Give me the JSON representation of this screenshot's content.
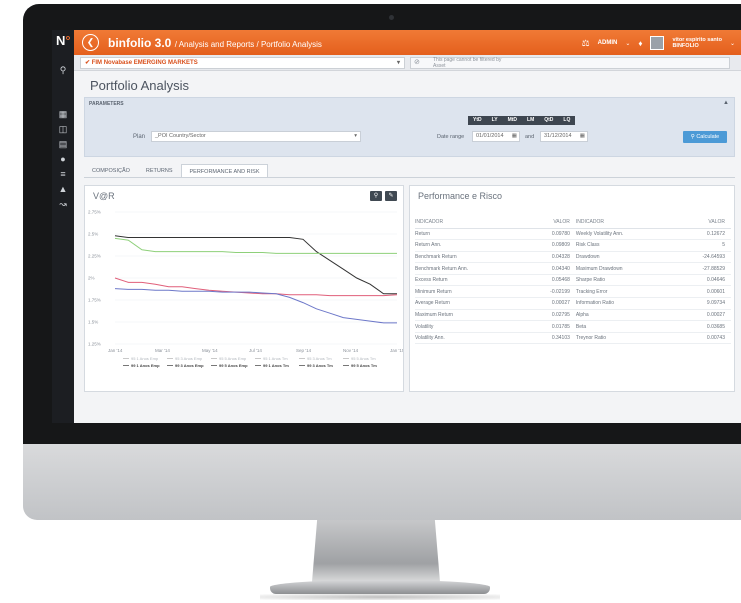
{
  "app": {
    "name": "binfolio 3.0",
    "breadcrumb": "/ Analysis and Reports / Portfolio Analysis",
    "back_icon": "chevron-left-icon"
  },
  "header": {
    "admin_label": "ADMIN",
    "user_name": "vitor espirito santo",
    "user_org": "BINFOLIO"
  },
  "toolbar": {
    "portfolio": "FIM Novabase EMERGING MARKETS",
    "filter_note_line1": "This page cannot be filtered by",
    "filter_note_line2": "Asset"
  },
  "page": {
    "title": "Portfolio Analysis"
  },
  "parameters": {
    "header": "PARAMETERS",
    "plan_label": "Plan",
    "plan_value": "_POI Country/Sector",
    "periods": [
      "YtD",
      "LY",
      "MtD",
      "LM",
      "QtD",
      "LQ"
    ],
    "date_range_label": "Date range",
    "date_from": "01/01/2014",
    "and_label": "and",
    "date_to": "31/12/2014",
    "calculate_label": "Calculate"
  },
  "tabs": [
    "COMPOSIÇÃO",
    "RETURNS",
    "PERFORMANCE AND RISK"
  ],
  "var_panel": {
    "title": "V@R"
  },
  "perf_panel": {
    "title": "Performance e Risco",
    "headers": [
      "INDICADOR",
      "VALOR",
      "INDICADOR",
      "VALOR"
    ],
    "rows": [
      [
        "Return",
        "0.09780",
        "Weekly Volatility Ann.",
        "0.12672"
      ],
      [
        "Return Ann.",
        "0.09809",
        "Risk Class",
        "5"
      ],
      [
        "Benchmark Return",
        "0.04328",
        "Drawdown",
        "-24.64593"
      ],
      [
        "Benchmark Return Ann.",
        "0.04340",
        "Maximum Drawdown",
        "-27.88529"
      ],
      [
        "Excess Return",
        "0.05468",
        "Sharpe Ratio",
        "0.04646"
      ],
      [
        "Minimum Return",
        "-0.02199",
        "Tracking Error",
        "0.00601"
      ],
      [
        "Average Return",
        "0.00027",
        "Information Ratio",
        "9.09734"
      ],
      [
        "Maximum Return",
        "0.02795",
        "Alpha",
        "0.00027"
      ],
      [
        "Volatility",
        "0.01785",
        "Beta",
        "0.03685"
      ],
      [
        "Volatility Ann.",
        "0.34103",
        "Treynor Ratio",
        "0.00743"
      ]
    ]
  },
  "chart_data": {
    "type": "line",
    "title": "V@R",
    "x": [
      "Jan '14",
      "Mar '14",
      "May '14",
      "Jul '14",
      "Sep '14",
      "Nov '14",
      "Jan '15"
    ],
    "y_ticks": [
      "1.25%",
      "1.5%",
      "1.75%",
      "2%",
      "2.25%",
      "2.5%",
      "2.75%"
    ],
    "ylim": [
      1.25,
      2.75
    ],
    "series": [
      {
        "name": "99 1 Anos Emp",
        "color": "#333333",
        "values": [
          2.48,
          2.46,
          2.46,
          2.46,
          2.46,
          2.46,
          2.46,
          2.46,
          2.46,
          2.46,
          2.46,
          2.46,
          2.46,
          2.46,
          2.44,
          2.3,
          2.2,
          2.1,
          2.0,
          1.93,
          1.82,
          1.82
        ]
      },
      {
        "name": "99 5 Anos Emp",
        "color": "#8ed07a",
        "values": [
          2.45,
          2.43,
          2.32,
          2.3,
          2.3,
          2.3,
          2.3,
          2.3,
          2.3,
          2.29,
          2.29,
          2.29,
          2.28,
          2.28,
          2.28,
          2.28,
          2.28,
          2.28,
          2.28,
          2.28,
          2.28,
          2.28
        ]
      },
      {
        "name": "99 1 Anos Tm",
        "color": "#e05f7a",
        "values": [
          2.0,
          1.95,
          1.95,
          1.93,
          1.9,
          1.9,
          1.88,
          1.86,
          1.85,
          1.84,
          1.83,
          1.82,
          1.82,
          1.81,
          1.81,
          1.81,
          1.8,
          1.8,
          1.8,
          1.8,
          1.8,
          1.81
        ]
      },
      {
        "name": "99 5 Anos Tm",
        "color": "#6d78c9",
        "values": [
          1.88,
          1.87,
          1.87,
          1.86,
          1.86,
          1.85,
          1.85,
          1.85,
          1.84,
          1.84,
          1.84,
          1.83,
          1.82,
          1.78,
          1.72,
          1.65,
          1.6,
          1.55,
          1.53,
          1.51,
          1.49,
          1.49
        ]
      }
    ],
    "legend": {
      "row1": [
        "95 1 Anos Emp",
        "95 3 Anos Emp",
        "95 5 Anos Emp",
        "95 1 Anos Tm",
        "95 3 Anos Tm",
        "95 5 Anos Tm"
      ],
      "row2": [
        "99 1 Anos Emp",
        "99 3 Anos Emp",
        "99 5 Anos Emp",
        "99 1 Anos Tm",
        "99 3 Anos Tm",
        "99 5 Anos Tm"
      ]
    }
  }
}
